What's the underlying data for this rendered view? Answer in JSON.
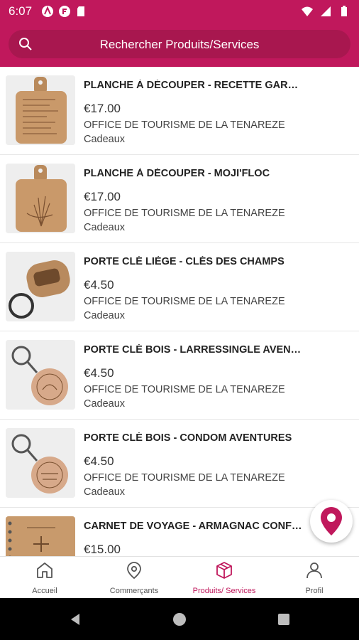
{
  "status_bar": {
    "time": "6:07"
  },
  "search": {
    "placeholder": "Rechercher Produits/Services"
  },
  "products": [
    {
      "title": "PLANCHE À DÉCOUPER - RECETTE GARBURE",
      "price": "€17.00",
      "vendor": "OFFICE DE TOURISME DE LA TENAREZE",
      "category": "Cadeaux",
      "thumb": "cutting-board-recipe"
    },
    {
      "title": "PLANCHE À DÉCOUPER - MOJI'FLOC",
      "price": "€17.00",
      "vendor": "OFFICE DE TOURISME DE LA TENAREZE",
      "category": "Cadeaux",
      "thumb": "cutting-board-mojifloc"
    },
    {
      "title": "PORTE CLÉ LIÈGE - CLÉS DES CHAMPS",
      "price": "€4.50",
      "vendor": "OFFICE DE TOURISME DE LA TENAREZE",
      "category": "Cadeaux",
      "thumb": "cork-keychain"
    },
    {
      "title": "PORTE CLÉ BOIS - LARRESSINGLE AVENTU...",
      "price": "€4.50",
      "vendor": "OFFICE DE TOURISME DE LA TENAREZE",
      "category": "Cadeaux",
      "thumb": "wood-keychain-larressingle"
    },
    {
      "title": "PORTE CLÉ BOIS - CONDOM AVENTURES",
      "price": "€4.50",
      "vendor": "OFFICE DE TOURISME DE LA TENAREZE",
      "category": "Cadeaux",
      "thumb": "wood-keychain-condom"
    },
    {
      "title": "CARNET DE VOYAGE - ARMAGNAC CONFID...",
      "price": "€15.00",
      "vendor": "",
      "category": "",
      "thumb": "travel-notebook"
    }
  ],
  "bottom_nav": [
    {
      "label": "Accueil",
      "icon": "home-icon",
      "active": false
    },
    {
      "label": "Commerçants",
      "icon": "map-pin-icon",
      "active": false
    },
    {
      "label": "Produits/ Services",
      "icon": "package-icon",
      "active": true
    },
    {
      "label": "Profil",
      "icon": "person-icon",
      "active": false
    }
  ],
  "colors": {
    "brand": "#c0185c",
    "brand_dark": "#a8174f"
  }
}
